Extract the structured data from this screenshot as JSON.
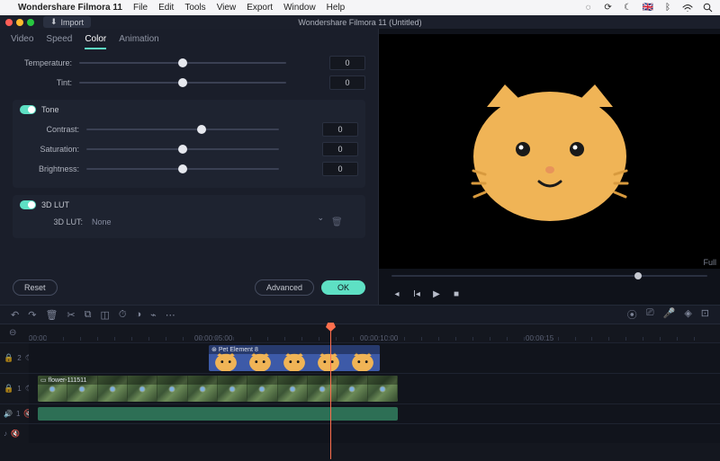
{
  "mac_menu": {
    "app": "Wondershare Filmora 11",
    "items": [
      "File",
      "Edit",
      "Tools",
      "View",
      "Export",
      "Window",
      "Help"
    ],
    "flag": "🇬🇧"
  },
  "titlebar": {
    "import_label": "Import",
    "window_title": "Wondershare Filmora 11 (Untitled)"
  },
  "tabs": [
    "Video",
    "Speed",
    "Color",
    "Animation"
  ],
  "active_tab_index": 2,
  "color_panel": {
    "temperature": {
      "label": "Temperature:",
      "value": 0,
      "pos": 50
    },
    "tint": {
      "label": "Tint:",
      "value": 0,
      "pos": 50
    },
    "tone_header": "Tone",
    "contrast": {
      "label": "Contrast:",
      "value": 0,
      "pos": 60
    },
    "saturation": {
      "label": "Saturation:",
      "value": 0,
      "pos": 50
    },
    "brightness": {
      "label": "Brightness:",
      "value": 0,
      "pos": 50
    },
    "lut_header": "3D LUT",
    "lut_label": "3D LUT:",
    "lut_value": "None"
  },
  "footer": {
    "reset": "Reset",
    "advanced": "Advanced",
    "ok": "OK"
  },
  "preview": {
    "full_label": "Full"
  },
  "ruler": {
    "labels": [
      "00:00",
      "00:00:05:00",
      "00:00:10:00",
      "00:00:15"
    ]
  },
  "tracks": {
    "t2": "2",
    "t1": "1",
    "audio": "1"
  },
  "clips": {
    "element_name": "Pet Element 8",
    "video_name": "flower-111511"
  }
}
